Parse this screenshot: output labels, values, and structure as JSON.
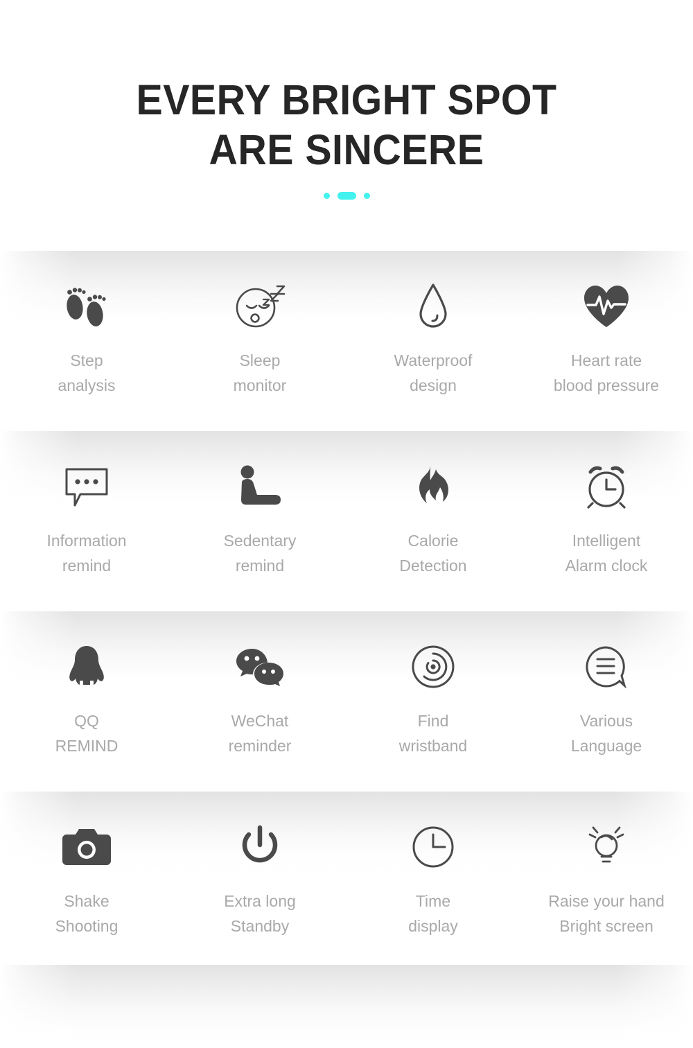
{
  "header": {
    "title_line1": "EVERY BRIGHT SPOT",
    "title_line2": "ARE SINCERE",
    "title_color": "#262626",
    "accent_color": "#43f2ee",
    "dots": [
      "dot-small",
      "dot-wide",
      "dot-small"
    ]
  },
  "theme": {
    "background": "#ffffff",
    "icon_color": "#4a4a4a",
    "label_color": "#a9a9a9",
    "band_color": "#e1e1e2"
  },
  "feature_rows": [
    {
      "row": 1,
      "features": [
        {
          "icon": "footprints-icon",
          "label": "Step\nanalysis"
        },
        {
          "icon": "sleeping-face-icon",
          "label": "Sleep\nmonitor"
        },
        {
          "icon": "water-drop-icon",
          "label": "Waterproof\ndesign"
        },
        {
          "icon": "heart-pulse-icon",
          "label": "Heart rate\nblood pressure"
        }
      ]
    },
    {
      "row": 2,
      "features": [
        {
          "icon": "speech-bubble-dots-icon",
          "label": "Information\nremind"
        },
        {
          "icon": "seated-person-icon",
          "label": "Sedentary\nremind"
        },
        {
          "icon": "flame-icon",
          "label": "Calorie\nDetection"
        },
        {
          "icon": "alarm-clock-icon",
          "label": "Intelligent\nAlarm clock"
        }
      ]
    },
    {
      "row": 3,
      "features": [
        {
          "icon": "qq-penguin-icon",
          "label": "QQ\nREMIND"
        },
        {
          "icon": "wechat-bubbles-icon",
          "label": "WeChat\nreminder"
        },
        {
          "icon": "radar-locator-icon",
          "label": "Find\nwristband"
        },
        {
          "icon": "speech-bubble-lines-icon",
          "label": "Various\nLanguage"
        }
      ]
    },
    {
      "row": 4,
      "features": [
        {
          "icon": "camera-icon",
          "label": "Shake\nShooting"
        },
        {
          "icon": "power-button-icon",
          "label": "Extra long\nStandby"
        },
        {
          "icon": "clock-icon",
          "label": "Time\ndisplay"
        },
        {
          "icon": "light-bulb-icon",
          "label": "Raise your hand\nBright screen"
        }
      ]
    }
  ]
}
